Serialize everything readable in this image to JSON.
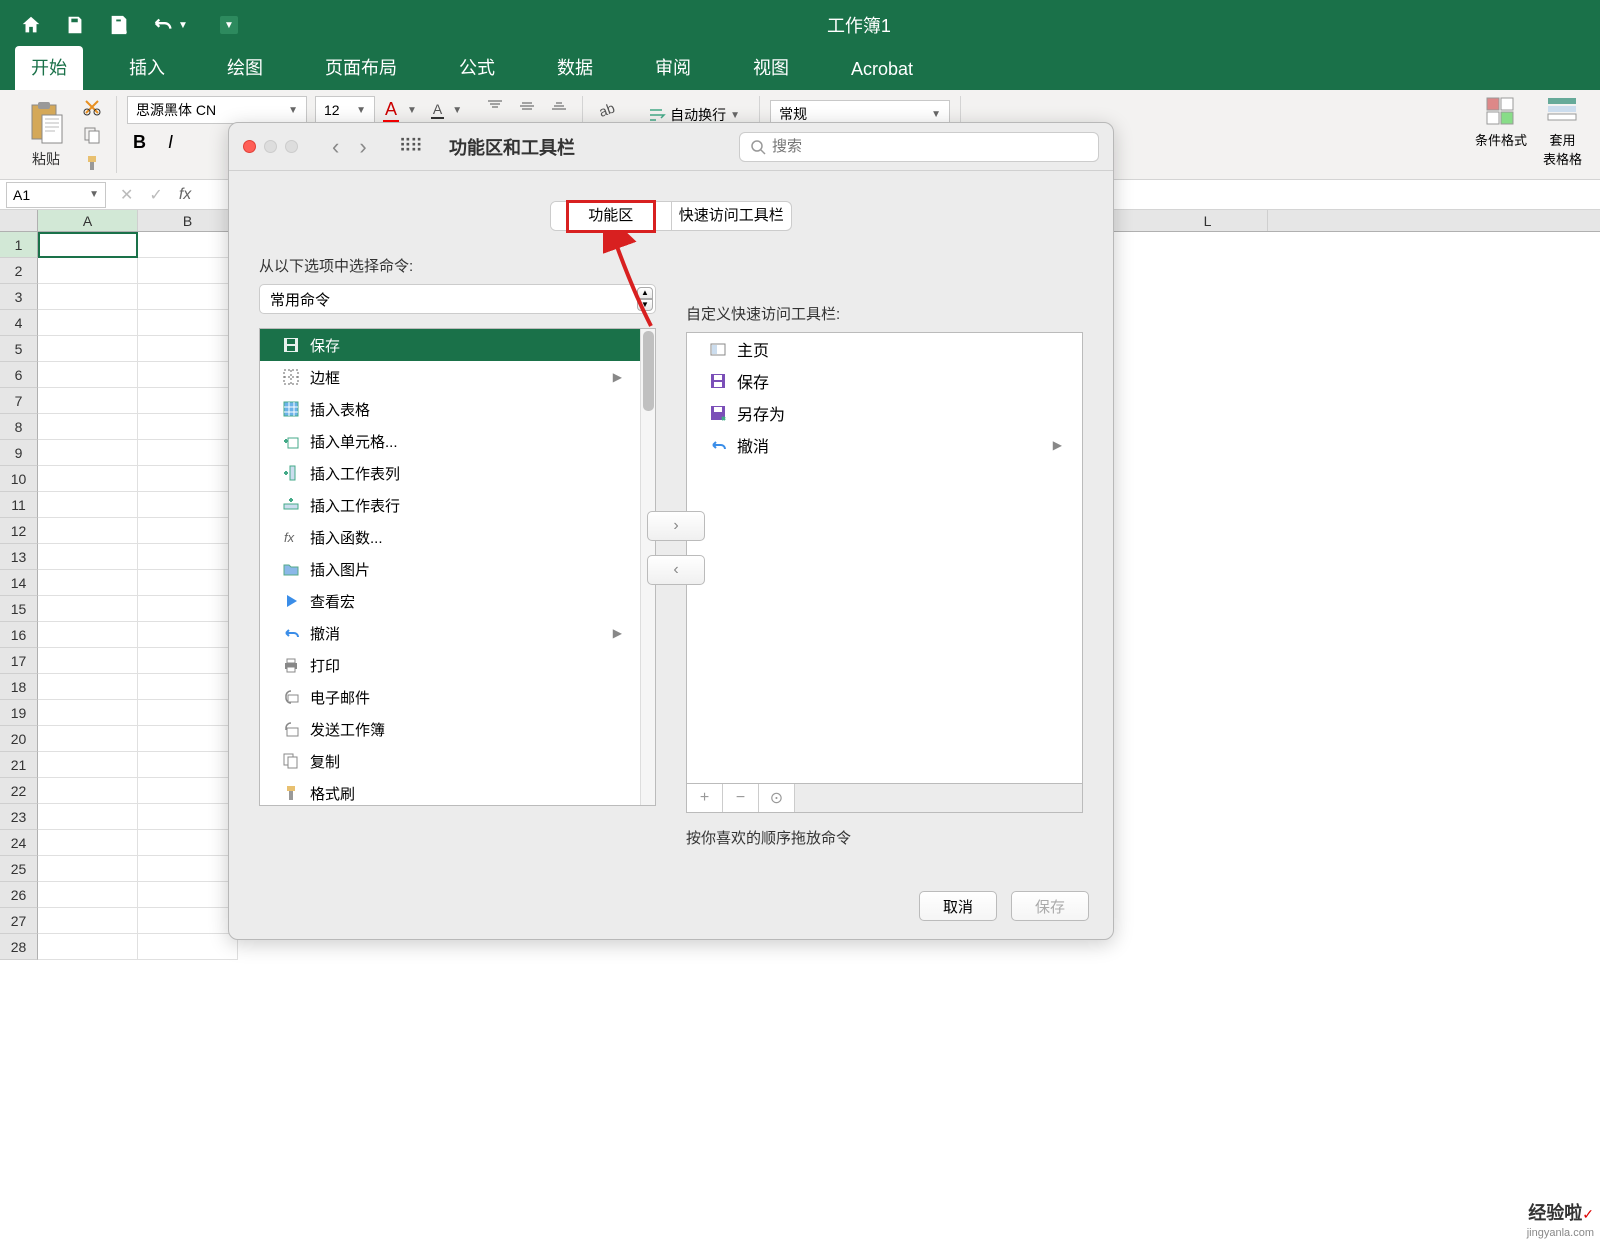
{
  "window": {
    "title": "工作簿1"
  },
  "tabs": [
    "开始",
    "插入",
    "绘图",
    "页面布局",
    "公式",
    "数据",
    "审阅",
    "视图",
    "Acrobat"
  ],
  "activeTab": 0,
  "ribbon": {
    "paste_label": "粘贴",
    "font_name": "思源黑体 CN",
    "font_size": "12",
    "wrap_label": "自动换行",
    "number_format": "常规",
    "cf_label": "条件格式",
    "table_fmt_label": "套用\n表格格"
  },
  "cell_ref": "A1",
  "columns": [
    "A",
    "B",
    "L"
  ],
  "dialog": {
    "title": "功能区和工具栏",
    "search_placeholder": "搜索",
    "seg1": "功能区",
    "seg2": "快速访问工具栏",
    "left_label": "从以下选项中选择命令:",
    "cmd_source": "常用命令",
    "right_label": "自定义快速访问工具栏:",
    "commands": [
      {
        "label": "保存",
        "icon": "save",
        "selected": true
      },
      {
        "label": "边框",
        "icon": "border",
        "submenu": true
      },
      {
        "label": "插入表格",
        "icon": "table"
      },
      {
        "label": "插入单元格...",
        "icon": "insert-cells"
      },
      {
        "label": "插入工作表列",
        "icon": "insert-col"
      },
      {
        "label": "插入工作表行",
        "icon": "insert-row"
      },
      {
        "label": "插入函数...",
        "icon": "fx"
      },
      {
        "label": "插入图片",
        "icon": "folder"
      },
      {
        "label": "查看宏",
        "icon": "play"
      },
      {
        "label": "撤消",
        "icon": "undo",
        "submenu": true
      },
      {
        "label": "打印",
        "icon": "print"
      },
      {
        "label": "电子邮件",
        "icon": "mail"
      },
      {
        "label": "发送工作簿",
        "icon": "send"
      },
      {
        "label": "复制",
        "icon": "copy"
      },
      {
        "label": "格式刷",
        "icon": "brush"
      }
    ],
    "qat_items": [
      {
        "label": "主页",
        "icon": "home"
      },
      {
        "label": "保存",
        "icon": "save"
      },
      {
        "label": "另存为",
        "icon": "saveas"
      },
      {
        "label": "撤消",
        "icon": "undo",
        "submenu": true
      }
    ],
    "hint": "按你喜欢的顺序拖放命令",
    "cancel": "取消",
    "save": "保存"
  },
  "watermark": {
    "brand": "经验啦",
    "url": "jingyanla.com"
  }
}
